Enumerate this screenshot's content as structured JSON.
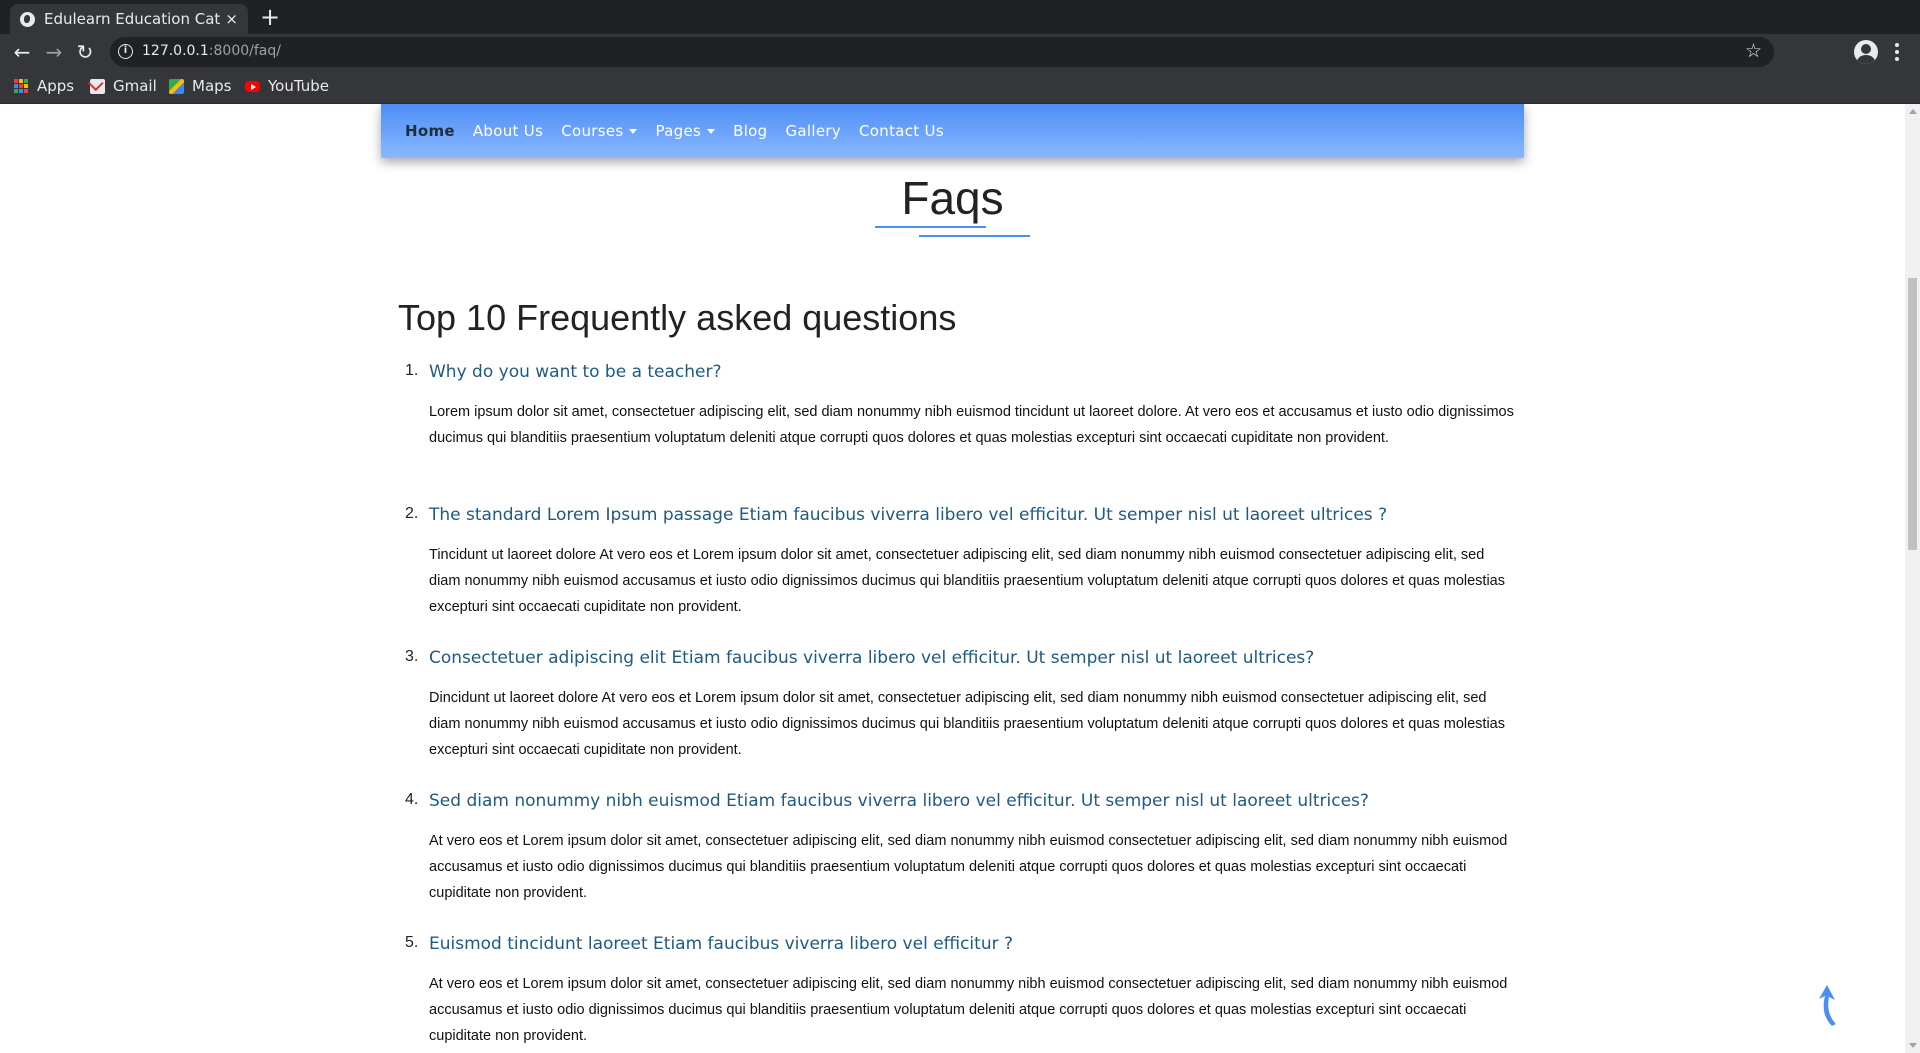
{
  "browser": {
    "tab_title": "Edulearn Education Categ",
    "tab_close": "×",
    "new_tab": "+",
    "url_host": "127.0.0.1",
    "url_path": ":8000/faq/",
    "bookmarks": [
      {
        "label": "Apps",
        "icon": "apps-icon"
      },
      {
        "label": "Gmail",
        "icon": "gmail-icon"
      },
      {
        "label": "Maps",
        "icon": "maps-icon"
      },
      {
        "label": "YouTube",
        "icon": "youtube-icon"
      }
    ]
  },
  "nav": {
    "items": [
      {
        "label": "Home",
        "active": true
      },
      {
        "label": "About Us"
      },
      {
        "label": "Courses",
        "dropdown": true
      },
      {
        "label": "Pages",
        "dropdown": true
      },
      {
        "label": "Blog"
      },
      {
        "label": "Gallery"
      },
      {
        "label": "Contact Us"
      }
    ],
    "gradient_top": "#4c8ef5",
    "gradient_bottom": "#8ab8ff"
  },
  "page": {
    "title": "Faqs",
    "heading": "Top 10 Frequently asked questions",
    "accent_color": "#1e5a82"
  },
  "faqs": [
    {
      "num": "1.",
      "question": "Why do you want to be a teacher?",
      "answer": "Lorem ipsum dolor sit amet, consectetuer adipiscing elit, sed diam nonummy nibh euismod tincidunt ut laoreet dolore. At vero eos et accusamus et iusto odio dignissimos ducimus qui blanditiis praesentium voluptatum deleniti atque corrupti quos dolores et quas molestias excepturi sint occaecati cupiditate non provident."
    },
    {
      "num": "2.",
      "question": "The standard Lorem Ipsum passage Etiam faucibus viverra libero vel efficitur. Ut semper nisl ut laoreet ultrices ?",
      "answer": "Tincidunt ut laoreet dolore At vero eos et Lorem ipsum dolor sit amet, consectetuer adipiscing elit, sed diam nonummy nibh euismod consectetuer adipiscing elit, sed diam nonummy nibh euismod accusamus et iusto odio dignissimos ducimus qui blanditiis praesentium voluptatum deleniti atque corrupti quos dolores et quas molestias excepturi sint occaecati cupiditate non provident."
    },
    {
      "num": "3.",
      "question": "Consectetuer adipiscing elit Etiam faucibus viverra libero vel efficitur. Ut semper nisl ut laoreet ultrices?",
      "answer": "Dincidunt ut laoreet dolore At vero eos et Lorem ipsum dolor sit amet, consectetuer adipiscing elit, sed diam nonummy nibh euismod consectetuer adipiscing elit, sed diam nonummy nibh euismod accusamus et iusto odio dignissimos ducimus qui blanditiis praesentium voluptatum deleniti atque corrupti quos dolores et quas molestias excepturi sint occaecati cupiditate non provident."
    },
    {
      "num": "4.",
      "question": "Sed diam nonummy nibh euismod Etiam faucibus viverra libero vel efficitur. Ut semper nisl ut laoreet ultrices?",
      "answer": "At vero eos et Lorem ipsum dolor sit amet, consectetuer adipiscing elit, sed diam nonummy nibh euismod consectetuer adipiscing elit, sed diam nonummy nibh euismod accusamus et iusto odio dignissimos ducimus qui blanditiis praesentium voluptatum deleniti atque corrupti quos dolores et quas molestias excepturi sint occaecati cupiditate non provident."
    },
    {
      "num": "5.",
      "question": "Euismod tincidunt laoreet Etiam faucibus viverra libero vel efficitur ?",
      "answer": "At vero eos et Lorem ipsum dolor sit amet, consectetuer adipiscing elit, sed diam nonummy nibh euismod consectetuer adipiscing elit, sed diam nonummy nibh euismod accusamus et iusto odio dignissimos ducimus qui blanditiis praesentium voluptatum deleniti atque corrupti quos dolores et quas molestias excepturi sint occaecati cupiditate non provident."
    }
  ]
}
